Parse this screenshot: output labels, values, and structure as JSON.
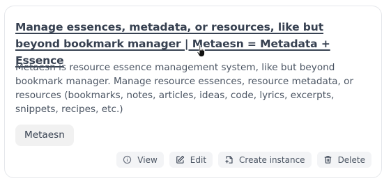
{
  "card": {
    "title": "Manage essences, metadata, or resources, like but beyond bookmark manager | Metaesn = Metadata + Essence",
    "description": "Metaesn is resource essence management system, like but beyond bookmark manager. Manage resource essences, resource metadata, or resources (bookmarks, notes, articles, ideas, code, lyrics, excerpts, snippets, recipes, etc.)",
    "tag": "Metaesn",
    "actions": [
      {
        "label": "View",
        "icon": "info-icon"
      },
      {
        "label": "Edit",
        "icon": "edit-icon"
      },
      {
        "label": "Create instance",
        "icon": "create-instance-icon"
      },
      {
        "label": "Delete",
        "icon": "trash-icon"
      }
    ]
  },
  "cursor": {
    "icon": "hand-pointer-icon"
  },
  "colors": {
    "title": "#374151",
    "text": "#4b5563",
    "button_bg": "#f3f4f6",
    "tag_bg": "#f1f1f1",
    "border": "#e5e7eb"
  }
}
